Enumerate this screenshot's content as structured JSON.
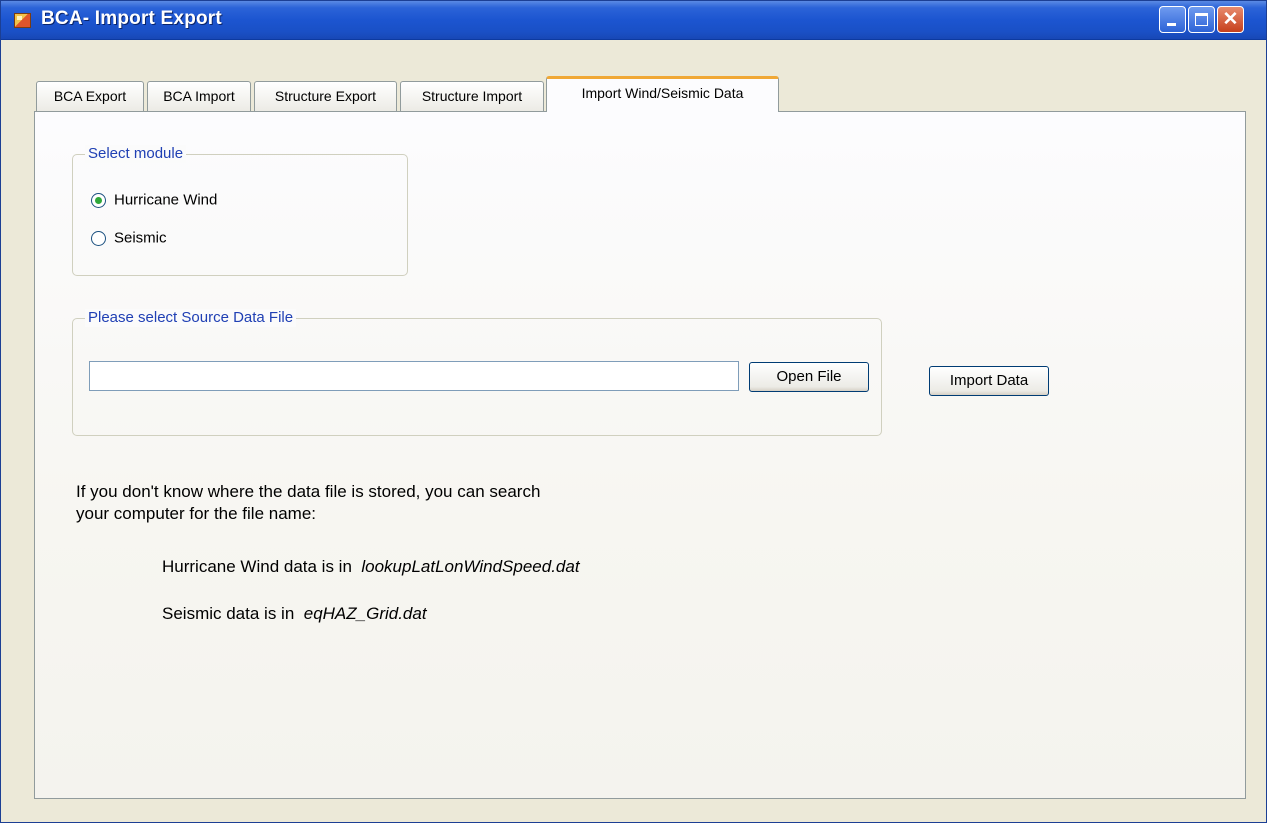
{
  "window": {
    "title": "BCA- Import Export"
  },
  "tabs": [
    {
      "label": "BCA Export"
    },
    {
      "label": "BCA Import"
    },
    {
      "label": "Structure Export"
    },
    {
      "label": "Structure Import"
    },
    {
      "label": "Import Wind/Seismic Data",
      "active": true
    }
  ],
  "module_group": {
    "legend": "Select module",
    "options": [
      {
        "label": "Hurricane Wind",
        "checked": true
      },
      {
        "label": "Seismic",
        "checked": false
      }
    ]
  },
  "source_group": {
    "legend": "Please select Source Data File",
    "file_path_value": "",
    "open_file_label": "Open File"
  },
  "import_button_label": "Import Data",
  "help": {
    "intro_line1": "If you don't know where the data file is stored, you can search",
    "intro_line2": "your computer for the file name:",
    "wind_prefix": "Hurricane Wind data is in",
    "wind_file": "lookupLatLonWindSpeed.dat",
    "seismic_prefix": "Seismic data is in",
    "seismic_file": "eqHAZ_Grid.dat"
  }
}
